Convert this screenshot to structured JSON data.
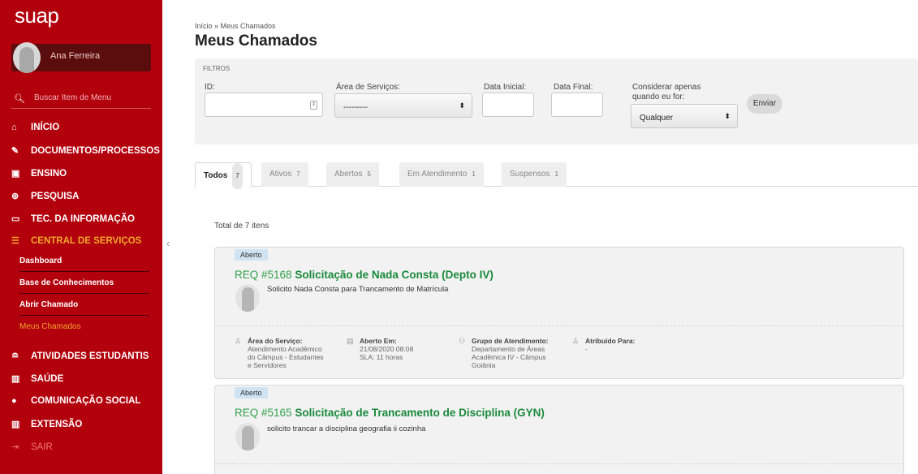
{
  "sidebar": {
    "logo": "suap",
    "user_name": "Ana Ferreira",
    "search_placeholder": "Buscar Item de Menu",
    "menu": [
      {
        "label": "INÍCIO",
        "icon": "home-icon"
      },
      {
        "label": "DOCUMENTOS/PROCESSOS",
        "icon": "documents-icon"
      },
      {
        "label": "ENSINO",
        "icon": "teaching-icon"
      },
      {
        "label": "PESQUISA",
        "icon": "research-icon"
      },
      {
        "label": "TEC. DA INFORMAÇÃO",
        "icon": "laptop-icon"
      },
      {
        "label": "CENTRAL DE SERVIÇOS",
        "icon": "list-icon",
        "active": true
      },
      {
        "label": "ATIVIDADES ESTUDANTIS",
        "icon": "graduation-icon"
      },
      {
        "label": "SAÚDE",
        "icon": "health-icon"
      },
      {
        "label": "COMUNICAÇÃO SOCIAL",
        "icon": "chat-icon"
      },
      {
        "label": "EXTENSÃO",
        "icon": "extension-icon"
      },
      {
        "label": "SAIR",
        "icon": "logout-icon"
      }
    ],
    "submenu": [
      {
        "label": "Dashboard"
      },
      {
        "label": "Base de Conhecimentos"
      },
      {
        "label": "Abrir Chamado"
      },
      {
        "label": "Meus Chamados",
        "current": true
      }
    ],
    "accent_color": "#b3000d",
    "active_color": "#f1a92b"
  },
  "header": {
    "breadcrumb": "Início » Meus Chamados",
    "title": "Meus Chamados"
  },
  "filters": {
    "legend": "FILTROS",
    "id_label": "ID:",
    "id_value": "",
    "area_label": "Área de Serviços:",
    "area_value": "---------",
    "start_label": "Data Inicial:",
    "start_value": "",
    "end_label": "Data Final:",
    "end_value": "",
    "consider_label": "Considerar apenas quando eu for:",
    "consider_value": "Qualquer",
    "submit_label": "Enviar"
  },
  "tabs": [
    {
      "label": "Todos",
      "count": "7",
      "active": true
    },
    {
      "label": "Ativos",
      "count": "7"
    },
    {
      "label": "Abertos",
      "count": "5"
    },
    {
      "label": "Em Atendimento",
      "count": "1"
    },
    {
      "label": "Suspensos",
      "count": "1"
    }
  ],
  "total_text": "Total de 7 itens",
  "tickets": [
    {
      "status": "Aberto",
      "req": "REQ #5168",
      "title": "Solicitação de Nada Consta (Depto IV)",
      "description": "Solicito Nada Consta para Trancamento de Matrícula",
      "area_label": "Área do Serviço:",
      "area_lines": [
        "Atendimento Acadêmico",
        "do Câmpus - Estudantes",
        "e Servidores"
      ],
      "opened_label": "Aberto Em:",
      "opened_date": "21/08/2020 08:08",
      "sla": "SLA: 11 horas",
      "group_label": "Grupo de Atendimento:",
      "group_lines": [
        "Departamento de Áreas",
        "Acadêmica IV - Câmpus",
        "Goiânia"
      ],
      "assigned_label": "Atribuído Para:",
      "assigned_value": "-"
    },
    {
      "status": "Aberto",
      "req": "REQ #5165",
      "title": "Solicitação de Trancamento de Disciplina (GYN)",
      "description": "solicito trancar a disciplina geografia ii cozinha"
    }
  ]
}
